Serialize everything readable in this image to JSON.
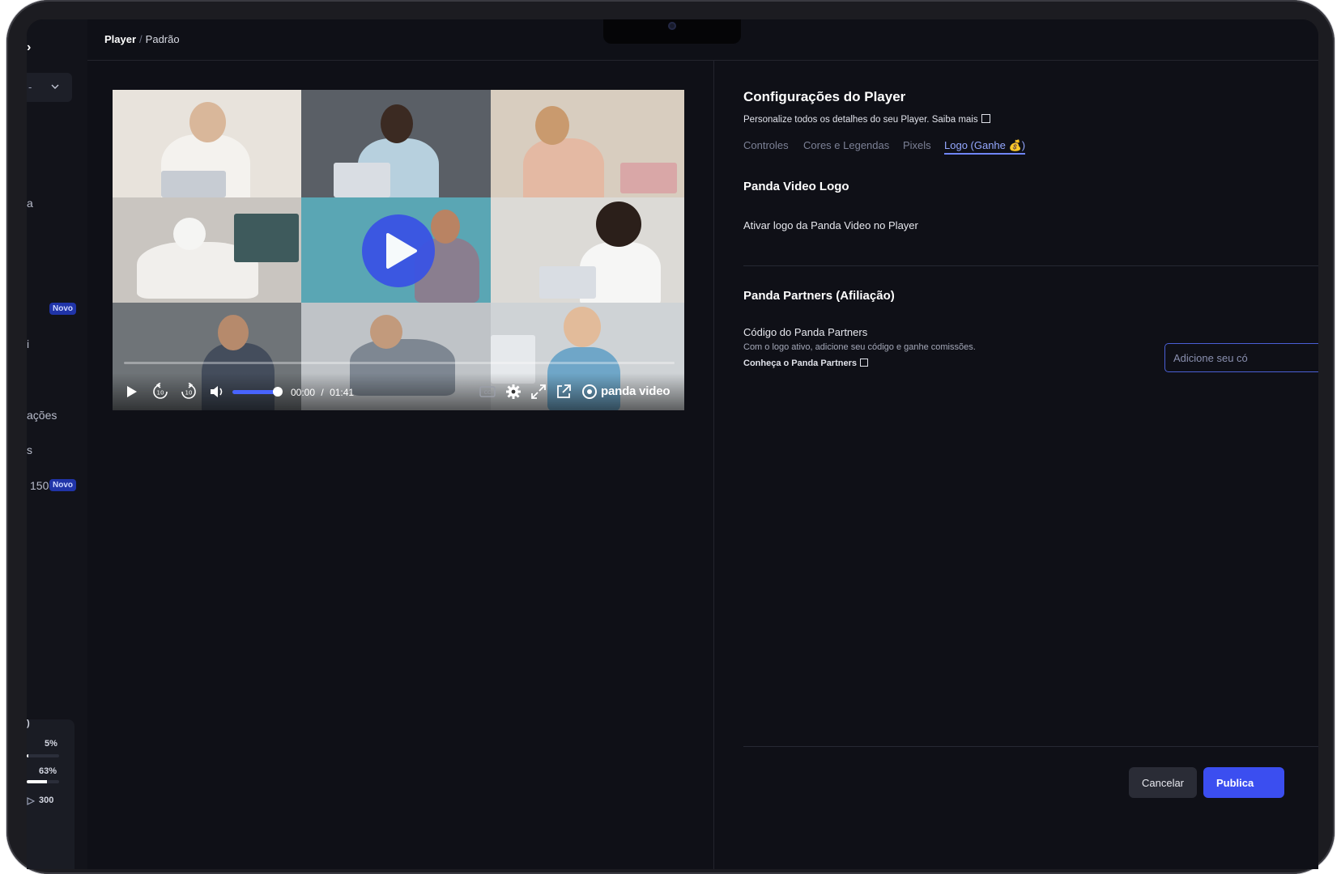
{
  "sidebar": {
    "logo": "›",
    "select_value": "-",
    "item_a": "a",
    "badge_new": "Novo",
    "item_ajuste": "i",
    "item_configuracoes": "ações",
    "item_s": "s",
    "item_150": "150",
    "badge_new_2": "Novo",
    "usage": {
      "label": ")",
      "first_pct": "5%",
      "first_value": 0.05,
      "second_pct": "63%",
      "second_value": 0.63,
      "count": "300"
    }
  },
  "breadcrumb": {
    "root": "Player",
    "separator": "/",
    "current": "Padrão"
  },
  "player": {
    "current_time": "00:00",
    "duration": "01:41",
    "time_separator": "/",
    "brand": "panda video",
    "volume": 0.9
  },
  "settings": {
    "title": "Configurações do Player",
    "subtitle": "Personalize todos os detalhes do seu Player.",
    "learn_more": "Saiba mais",
    "tabs": [
      {
        "label": "Controles",
        "active": false
      },
      {
        "label": "Cores e Legendas",
        "active": false
      },
      {
        "label": "Pixels",
        "active": false
      },
      {
        "label": "Logo (Ganhe 💰)",
        "active": true
      }
    ],
    "section_logo": {
      "title": "Panda Video Logo",
      "toggle_label": "Ativar logo da Panda Video no Player"
    },
    "section_partners": {
      "title": "Panda Partners (Afiliação)",
      "field_label": "Código do Panda Partners",
      "help": "Com o logo ativo, adicione seu código e ganhe comissões.",
      "link": "Conheça o Panda Partners",
      "placeholder": "Adicione seu có"
    },
    "actions": {
      "cancel": "Cancelar",
      "publish": "Publica"
    }
  }
}
